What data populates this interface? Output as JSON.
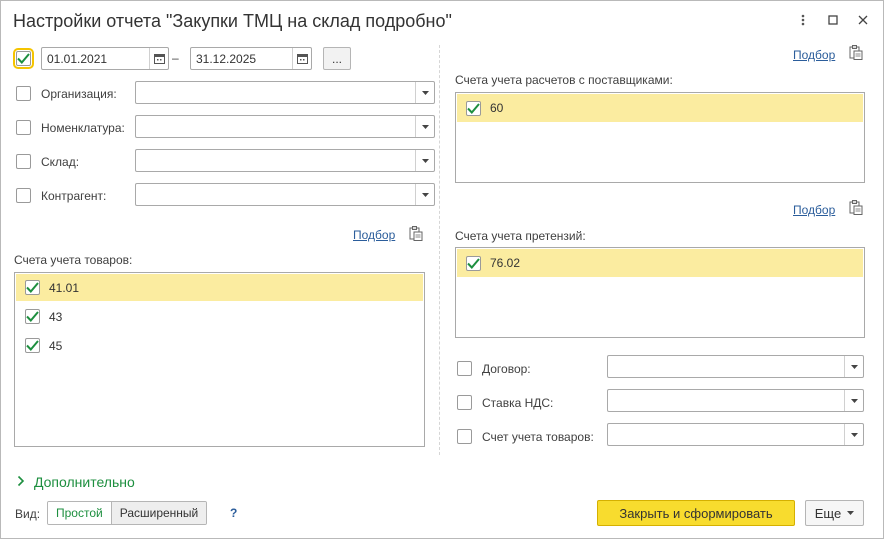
{
  "window": {
    "title": "Настройки отчета \"Закупки ТМЦ на склад подробно\""
  },
  "period": {
    "checked": true,
    "date_from": "01.01.2021",
    "separator": "–",
    "date_to": "31.12.2025",
    "more_label": "..."
  },
  "filters": [
    {
      "label": "Организация:",
      "value": ""
    },
    {
      "label": "Номенклатура:",
      "value": ""
    },
    {
      "label": "Склад:",
      "value": ""
    },
    {
      "label": "Контрагент:",
      "value": ""
    }
  ],
  "goods_accounts": {
    "pick_label": "Подбор",
    "title": "Счета учета товаров:",
    "items": [
      {
        "value": "41.01",
        "checked": true,
        "selected": true
      },
      {
        "value": "43",
        "checked": true,
        "selected": false
      },
      {
        "value": "45",
        "checked": true,
        "selected": false
      }
    ]
  },
  "supplier_accounts": {
    "pick_label": "Подбор",
    "title": "Счета учета расчетов с поставщиками:",
    "items": [
      {
        "value": "60",
        "checked": true,
        "selected": true
      }
    ]
  },
  "claims_accounts": {
    "pick_label": "Подбор",
    "title": "Счета учета претензий:",
    "items": [
      {
        "value": "76.02",
        "checked": true,
        "selected": true
      }
    ]
  },
  "right_filters": [
    {
      "label": "Договор:",
      "value": ""
    },
    {
      "label": "Ставка НДС:",
      "value": ""
    },
    {
      "label": "Счет учета товаров:",
      "value": ""
    }
  ],
  "extra": {
    "label": "Дополнительно"
  },
  "view": {
    "label": "Вид:",
    "simple": "Простой",
    "advanced": "Расширенный",
    "help": "?"
  },
  "actions": {
    "submit": "Закрыть и сформировать",
    "more": "Еще"
  },
  "colors": {
    "accent_yellow": "#f8dc2e",
    "selection": "#fbeca0",
    "link": "#2b5d9b",
    "green": "#1d8f3f"
  }
}
